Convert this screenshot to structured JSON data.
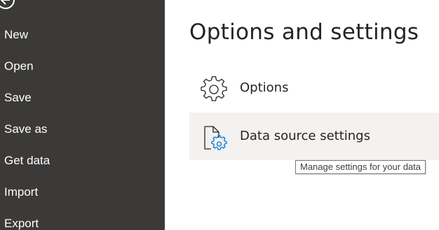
{
  "sidebar": {
    "items": [
      {
        "label": "New"
      },
      {
        "label": "Open"
      },
      {
        "label": "Save"
      },
      {
        "label": "Save as"
      },
      {
        "label": "Get data"
      },
      {
        "label": "Import"
      },
      {
        "label": "Export"
      }
    ]
  },
  "main": {
    "title": "Options and settings",
    "options": [
      {
        "label": "Options",
        "icon": "gear-icon"
      },
      {
        "label": "Data source settings",
        "icon": "data-source-settings-icon"
      }
    ],
    "tooltip": "Manage settings for your data"
  },
  "colors": {
    "sidebar_bg": "#3b3a39",
    "hover_row_bg": "#f3f2f1",
    "icon_accent": "#0078d4"
  }
}
